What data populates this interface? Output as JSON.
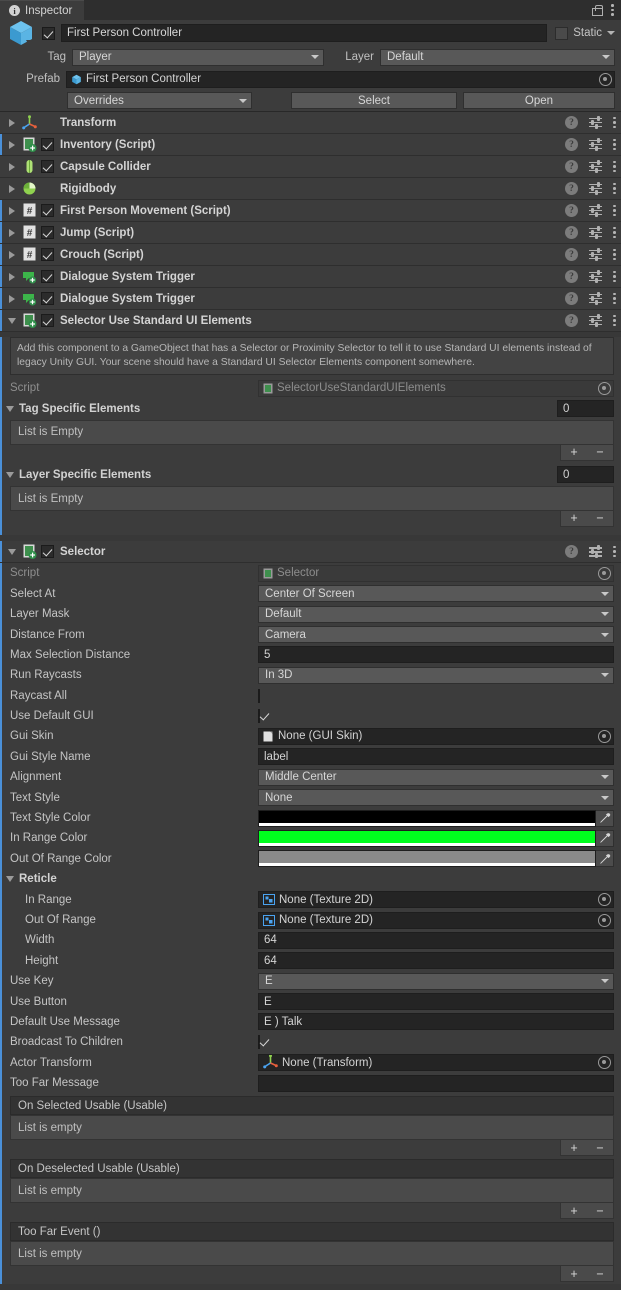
{
  "window": {
    "tab_label": "Inspector",
    "info_icon": "info-icon",
    "lock_icon": "lock-icon",
    "menu_icon": "kebab-menu-icon"
  },
  "gameobject": {
    "enabled": true,
    "name": "First Person Controller",
    "static_label": "Static",
    "static_checked": false,
    "tag_label": "Tag",
    "tag_value": "Player",
    "layer_label": "Layer",
    "layer_value": "Default",
    "prefab_label": "Prefab",
    "prefab_value": "First Person Controller",
    "overrides_label": "Overrides",
    "select_label": "Select",
    "open_label": "Open"
  },
  "components": [
    {
      "name": "Transform",
      "icon": "transform-icon",
      "expanded": false,
      "has_toggle": false,
      "enabled": false,
      "overridden": false
    },
    {
      "name": "Inventory (Script)",
      "icon": "script-icon",
      "expanded": false,
      "has_toggle": true,
      "enabled": true,
      "overridden": true
    },
    {
      "name": "Capsule Collider",
      "icon": "capsule-collider-icon",
      "expanded": false,
      "has_toggle": true,
      "enabled": true,
      "overridden": false
    },
    {
      "name": "Rigidbody",
      "icon": "rigidbody-icon",
      "expanded": false,
      "has_toggle": false,
      "enabled": false,
      "overridden": false
    },
    {
      "name": "First Person Movement (Script)",
      "icon": "csharp-script-icon",
      "expanded": false,
      "has_toggle": true,
      "enabled": true,
      "overridden": true
    },
    {
      "name": "Jump (Script)",
      "icon": "csharp-script-icon",
      "expanded": false,
      "has_toggle": true,
      "enabled": true,
      "overridden": true
    },
    {
      "name": "Crouch (Script)",
      "icon": "csharp-script-icon",
      "expanded": false,
      "has_toggle": true,
      "enabled": true,
      "overridden": true
    },
    {
      "name": "Dialogue System Trigger",
      "icon": "dialogue-trigger-icon",
      "expanded": false,
      "has_toggle": true,
      "enabled": true,
      "overridden": true
    },
    {
      "name": "Dialogue System Trigger",
      "icon": "dialogue-trigger-icon",
      "expanded": false,
      "has_toggle": true,
      "enabled": true,
      "overridden": true
    },
    {
      "name": "Selector Use Standard UI Elements",
      "icon": "script-icon",
      "expanded": true,
      "has_toggle": true,
      "enabled": true,
      "overridden": true
    }
  ],
  "selector_use_standard_ui": {
    "help_text": "Add this component to a GameObject that has a Selector or Proximity Selector to tell it to use Standard UI elements instead of legacy Unity GUI. Your scene should have a Standard UI Selector Elements component somewhere.",
    "script_label": "Script",
    "script_value": "SelectorUseStandardUIElements",
    "tag_specific_label": "Tag Specific Elements",
    "tag_specific_size": "0",
    "tag_specific_empty": "List is Empty",
    "layer_specific_label": "Layer Specific Elements",
    "layer_specific_size": "0",
    "layer_specific_empty": "List is Empty",
    "add_label": "+",
    "remove_label": "−"
  },
  "selector": {
    "header": "Selector",
    "enabled": true,
    "script_label": "Script",
    "script_value": "Selector",
    "rows": [
      {
        "label": "Select At",
        "type": "dropdown",
        "value": "Center Of Screen"
      },
      {
        "label": "Layer Mask",
        "type": "dropdown",
        "value": "Default"
      },
      {
        "label": "Distance From",
        "type": "dropdown",
        "value": "Camera"
      },
      {
        "label": "Max Selection Distance",
        "type": "text",
        "value": "5"
      },
      {
        "label": "Run Raycasts",
        "type": "dropdown",
        "value": "In 3D"
      },
      {
        "label": "Raycast All",
        "type": "checkbox",
        "value": false
      },
      {
        "label": "Use Default GUI",
        "type": "checkbox",
        "value": true
      },
      {
        "label": "Gui Skin",
        "type": "object",
        "value": "None (GUI Skin)",
        "obj_icon": "guiskin-icon"
      },
      {
        "label": "Gui Style Name",
        "type": "text",
        "value": "label"
      },
      {
        "label": "Alignment",
        "type": "dropdown",
        "value": "Middle Center"
      },
      {
        "label": "Text Style",
        "type": "dropdown",
        "value": "None"
      },
      {
        "label": "Text Style Color",
        "type": "color",
        "value": "#000000"
      },
      {
        "label": "In Range Color",
        "type": "color",
        "value": "#00ff1e"
      },
      {
        "label": "Out Of Range Color",
        "type": "color",
        "value": "#8a8a8a"
      }
    ],
    "reticle_label": "Reticle",
    "reticle_rows": [
      {
        "label": "In Range",
        "type": "object",
        "value": "None (Texture 2D)",
        "obj_icon": "texture2d-icon"
      },
      {
        "label": "Out Of Range",
        "type": "object",
        "value": "None (Texture 2D)",
        "obj_icon": "texture2d-icon"
      },
      {
        "label": "Width",
        "type": "text",
        "value": "64"
      },
      {
        "label": "Height",
        "type": "text",
        "value": "64"
      }
    ],
    "rows2": [
      {
        "label": "Use Key",
        "type": "dropdown",
        "value": "E"
      },
      {
        "label": "Use Button",
        "type": "text",
        "value": "E"
      },
      {
        "label": "Default Use Message",
        "type": "text",
        "value": "E ) Talk"
      },
      {
        "label": "Broadcast To Children",
        "type": "checkbox",
        "value": true
      },
      {
        "label": "Actor Transform",
        "type": "object",
        "value": "None (Transform)",
        "obj_icon": "transform-icon"
      },
      {
        "label": "Too Far Message",
        "type": "text",
        "value": ""
      }
    ],
    "events": [
      {
        "title": "On Selected Usable (Usable)",
        "empty": "List is empty"
      },
      {
        "title": "On Deselected Usable (Usable)",
        "empty": "List is empty"
      },
      {
        "title": "Too Far Event ()",
        "empty": "List is empty"
      }
    ],
    "add_label": "+",
    "remove_label": "−"
  },
  "colors": {
    "panel_bg": "#3c3c3c",
    "window_bg": "#383838",
    "field_bg": "#242424",
    "dropdown_bg": "#585858",
    "accent_override": "#4a90d9",
    "in_range_green": "#00ff1e"
  }
}
